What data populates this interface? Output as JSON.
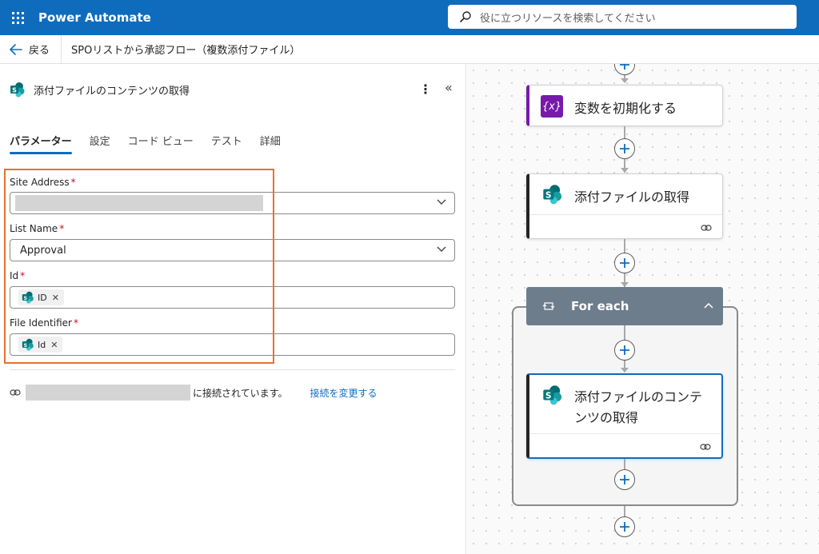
{
  "app": {
    "title": "Power Automate"
  },
  "search": {
    "placeholder": "役に立つリソースを検索してください"
  },
  "cmdbar": {
    "back_label": "戻る",
    "flow_title": "SPOリストから承認フロー（複数添付ファイル）"
  },
  "panel": {
    "title": "添付ファイルのコンテンツの取得",
    "tabs": [
      "パラメーター",
      "設定",
      "コード ビュー",
      "テスト",
      "詳細"
    ],
    "fields": {
      "site_address": {
        "label": "Site Address",
        "required": "*",
        "value": ""
      },
      "list_name": {
        "label": "List Name",
        "required": "*",
        "value": "Approval"
      },
      "id": {
        "label": "Id",
        "required": "*",
        "token": "ID"
      },
      "file_identifier": {
        "label": "File Identifier",
        "required": "*",
        "token": "Id"
      }
    },
    "connection": {
      "status": "に接続されています。",
      "change_link": "接続を変更する"
    }
  },
  "canvas": {
    "cards": {
      "init_variable": "変数を初期化する",
      "get_attachments": "添付ファイルの取得",
      "foreach": "For each",
      "get_attachment_content_line1": "添付ファイルのコンテ",
      "get_attachment_content_line2": "ンツの取得"
    }
  },
  "colors": {
    "brand": "#0f6cbd",
    "highlight": "#e8712b",
    "variable_accent": "#7719aa",
    "sharepoint_teal": "#038387",
    "foreach_header": "#6e7d8c"
  },
  "icons": [
    "waffle-icon",
    "search-icon",
    "back-arrow-icon",
    "sharepoint-icon",
    "more-icon",
    "collapse-icon",
    "chevron-down-icon",
    "link-icon",
    "variable-icon",
    "loop-icon",
    "chevron-up-icon",
    "plus-icon",
    "close-icon"
  ]
}
